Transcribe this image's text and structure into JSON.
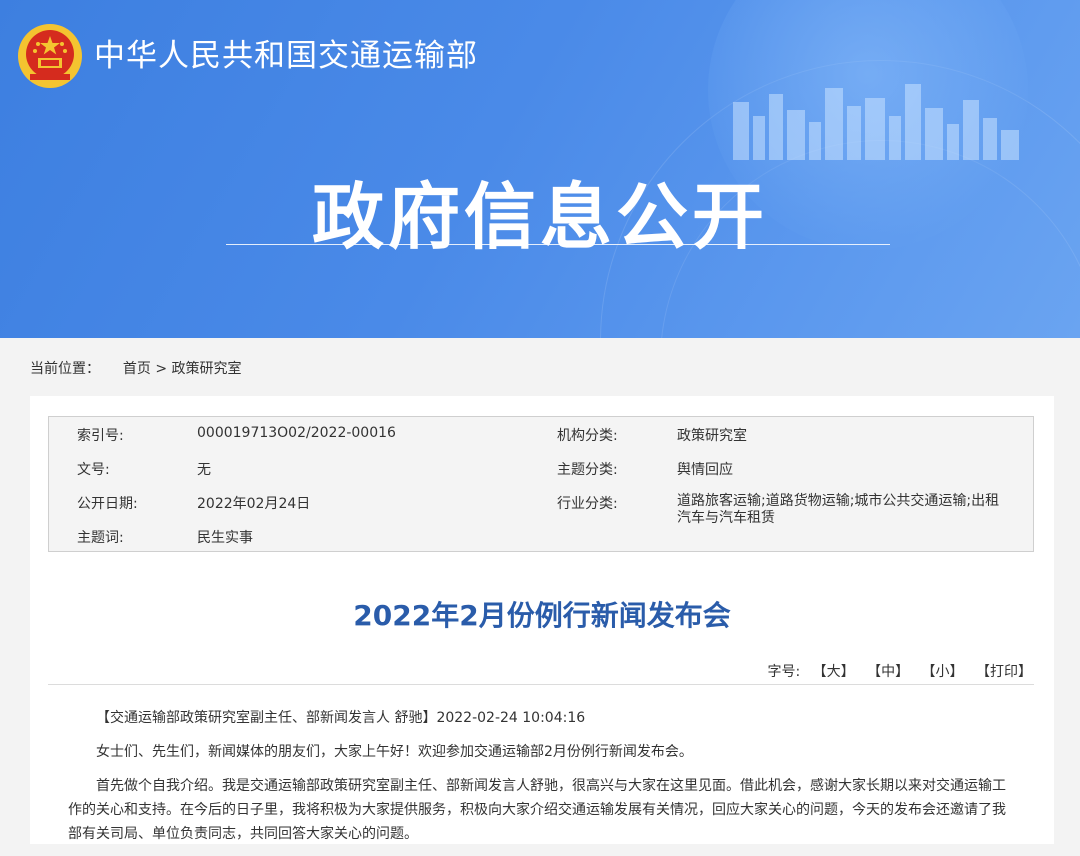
{
  "header": {
    "ministry_name": "中华人民共和国交通运输部",
    "section_title": "政府信息公开",
    "colors": {
      "banner": "#4a8ae8",
      "emblem_red": "#d52b1e",
      "emblem_gold": "#f4c430"
    }
  },
  "breadcrumb": {
    "label": "当前位置：",
    "home": "首页",
    "separator": ">",
    "current": "政策研究室"
  },
  "meta": {
    "index_no_label": "索引号:",
    "index_no": "000019713O02/2022-00016",
    "agency_label": "机构分类:",
    "agency": "政策研究室",
    "doc_no_label": "文号:",
    "doc_no": "无",
    "topic_label": "主题分类:",
    "topic": "舆情回应",
    "date_label": "公开日期:",
    "date": "2022年02月24日",
    "industry_label": "行业分类:",
    "industry": "道路旅客运输;道路货物运输;城市公共交通运输;出租汽车与汽车租赁",
    "keyword_label": "主题词:",
    "keyword": "民生实事"
  },
  "article": {
    "title": "2022年2月份例行新闻发布会",
    "title_color": "#2a5caa",
    "font_label": "字号:",
    "font_large": "【大】",
    "font_medium": "【中】",
    "font_small": "【小】",
    "print": "【打印】",
    "paragraphs": [
      "【交通运输部政策研究室副主任、部新闻发言人 舒驰】2022-02-24 10:04:16",
      "女士们、先生们，新闻媒体的朋友们，大家上午好！欢迎参加交通运输部2月份例行新闻发布会。",
      "首先做个自我介绍。我是交通运输部政策研究室副主任、部新闻发言人舒驰，很高兴与大家在这里见面。借此机会，感谢大家长期以来对交通运输工作的关心和支持。在今后的日子里，我将积极为大家提供服务，积极向大家介绍交通运输发展有关情况，回应大家关心的问题，今天的发布会还邀请了我部有关司局、单位负责同志，共同回答大家关心的问题。"
    ]
  }
}
